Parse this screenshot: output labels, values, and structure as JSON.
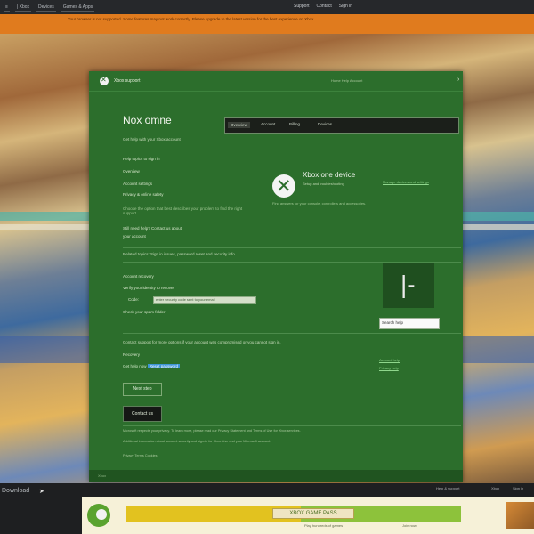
{
  "topbar": {
    "nav": [
      "≡",
      "| Xbox",
      "Devices",
      "Games & Apps"
    ],
    "right": [
      "Support",
      "Contact",
      "Sign in"
    ]
  },
  "alert": {
    "message": "Your browser is not supported. Some features may not work correctly. Please upgrade to the latest version for the best experience on Xbox."
  },
  "panel": {
    "brand": "Xbox support",
    "header_links": "Home  Help  Account",
    "title": "Nox omne",
    "tabs": [
      "Overview",
      "Account",
      "Billing",
      "Devices"
    ],
    "intro": "Get help with your Xbox account",
    "section_label": "Help topics to sign in",
    "options": [
      "Overview",
      "Account settings",
      "Privacy & online safety"
    ],
    "option_desc": "Choose the option that best describes your problem to find the right support.",
    "secondary": [
      "Still need help? Contact us about",
      "your account"
    ],
    "feature_title": "Xbox one device",
    "feature_sub": "Setup and troubleshooting",
    "feature_desc": "Find answers for your console, controllers and accessories.",
    "right_link": "Manage devices and settings",
    "divider_text": "Related topics: Sign in issues, password reset and security info",
    "block1": [
      "Account recovery",
      "Verify your identity to recover",
      "Code:"
    ],
    "code_value": "enter security code sent to your email",
    "block1_note": "Check your spam folder",
    "input_label": "Search help",
    "info_text": "Contact support for more options if your account was compromised or you cannot sign in.",
    "row_label": "Recovery",
    "link_a": "Get help now",
    "link_b": "Reset password",
    "right_links": [
      "Account help",
      "Privacy help"
    ],
    "btn_outline": "Next step",
    "btn_dark": "Contact us",
    "footer_lines": [
      "Microsoft respects your privacy. To learn more, please read our Privacy Statement and Terms of Use for Xbox services.",
      "Additional information about account security and sign-in for Xbox Live and your Microsoft account.",
      "Privacy  Terms  Cookies"
    ],
    "footer": "Xbox"
  },
  "bottombar": {
    "label": "Download",
    "links": [
      "Help & support",
      "Xbox",
      "Sign in"
    ]
  },
  "banner": {
    "headline": "XBOX GAME PASS",
    "sub": [
      "Play hundreds of games",
      "Join now"
    ]
  }
}
